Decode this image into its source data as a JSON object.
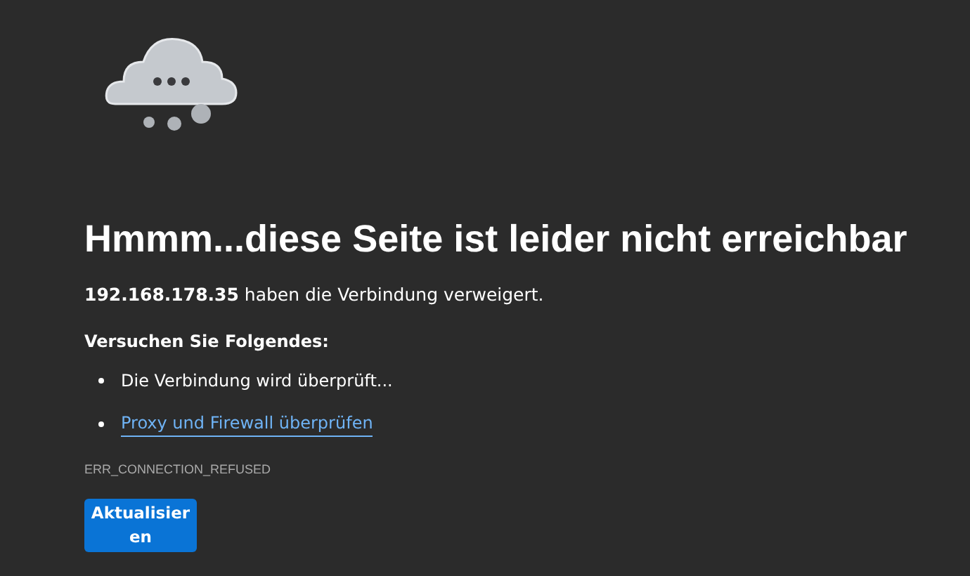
{
  "heading": "Hmmm...diese Seite ist leider nicht erreichbar",
  "message": "**192.168.178.35** haben die Verbindung verweigert.",
  "suggestions_title": "Versuchen Sie Folgendes:",
  "suggestions": [
    {
      "kind": "text",
      "text": "Die Verbindung wird überprüft..."
    },
    {
      "kind": "link",
      "text": "Proxy und Firewall überprüfen"
    }
  ],
  "error_code": "ERR_CONNECTION_REFUSED",
  "button": "Aktualisieren"
}
